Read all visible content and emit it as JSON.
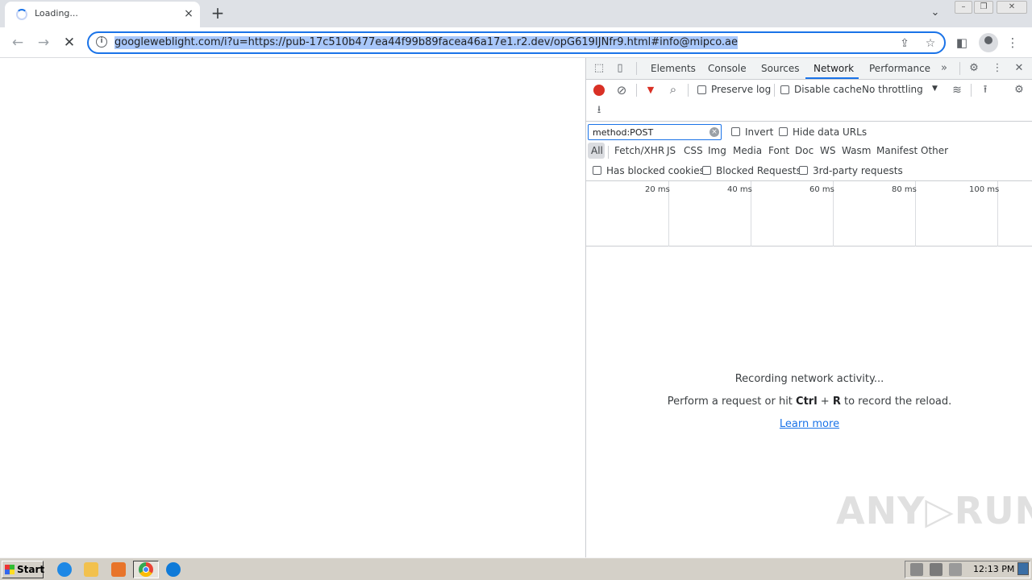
{
  "browser": {
    "tab": {
      "title": "Loading...",
      "close_icon": "×"
    },
    "new_tab_icon": "+",
    "tab_search_icon": "⌄",
    "window_controls": {
      "minimize": "–",
      "restore": "❐",
      "close": "✕"
    },
    "nav": {
      "back_icon": "←",
      "forward_icon": "→",
      "stop_icon": "✕"
    },
    "address_bar": {
      "url": "googleweblight.com/i?u=https://pub-17c510b477ea44f99b89facea46a17e1.r2.dev/opG619IJNfr9.html#info@mipco.ae",
      "info_icon": "i",
      "share_icon": "⇪",
      "bookmark_icon": "☆"
    },
    "side_panel_icon": "◧",
    "menu_icon": "⋮"
  },
  "devtools": {
    "tabs": [
      "Elements",
      "Console",
      "Sources",
      "Network",
      "Performance"
    ],
    "active_tab": "Network",
    "more_tabs_icon": "»",
    "settings_icon": "⚙",
    "kebab_icon": "⋮",
    "close_icon": "✕",
    "toolbar": {
      "clear_icon": "⊘",
      "filter_icon": "▼",
      "search_icon": "⌕",
      "preserve_log": "Preserve log",
      "disable_cache": "Disable cache",
      "throttling": "No throttling",
      "throttling_arrow": "▼",
      "network_conditions_icon": "≋",
      "import_icon": "⭱",
      "export_icon": "⭳",
      "settings_icon": "⚙"
    },
    "filter": {
      "value": "method:POST",
      "clear_icon": "×",
      "invert": "Invert",
      "hide_data_urls": "Hide data URLs",
      "types": [
        "All",
        "Fetch/XHR",
        "JS",
        "CSS",
        "Img",
        "Media",
        "Font",
        "Doc",
        "WS",
        "Wasm",
        "Manifest",
        "Other"
      ],
      "has_blocked_cookies": "Has blocked cookies",
      "blocked_requests": "Blocked Requests",
      "third_party": "3rd-party requests"
    },
    "timeline": {
      "ticks": [
        "20 ms",
        "40 ms",
        "60 ms",
        "80 ms",
        "100 ms"
      ]
    },
    "empty_state": {
      "line1": "Recording network activity...",
      "line2_pre": "Perform a request or hit ",
      "line2_key1": "Ctrl",
      "line2_plus": " + ",
      "line2_key2": "R",
      "line2_post": " to record the reload.",
      "learn_more": "Learn more"
    },
    "watermark": "ANY▷RUN"
  },
  "taskbar": {
    "start": "Start",
    "clock": "12:13 PM",
    "colors": {
      "ie": "#1e88e5",
      "explorer": "#f2c14e",
      "media": "#e8742a",
      "chrome": "#34a853",
      "edge": "#0f7ad8"
    }
  }
}
